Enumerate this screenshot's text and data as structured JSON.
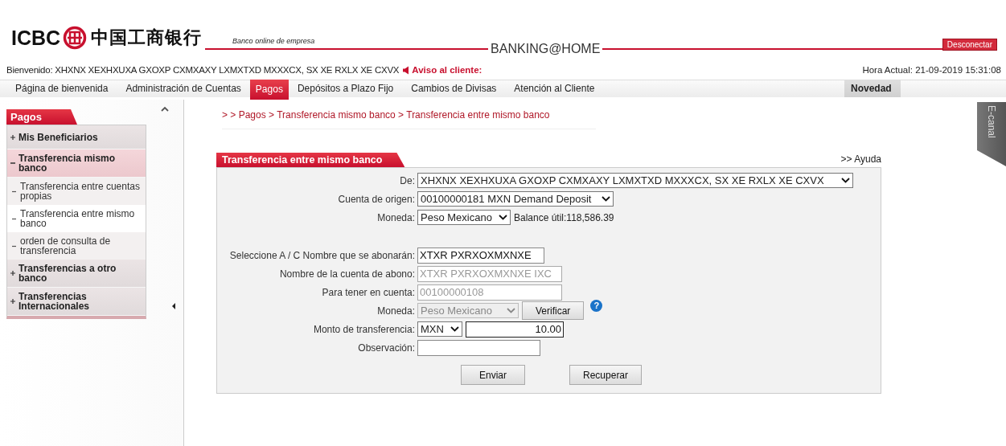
{
  "header": {
    "brand": "ICBC",
    "brand_cn": "中国工商银行",
    "tagline": "Banco online de empresa",
    "product": "BANKING@HOME",
    "logout": "Desconectar"
  },
  "welcome": {
    "label": "Bienvenido: XHXNX XEXHXUXA GXOXP CXMXAXY LXMXTXD MXXXCX, SX XE RXLX XE CXVX",
    "notice": "Aviso al cliente:",
    "clock": "Hora Actual: 21-09-2019 15:31:08"
  },
  "nav": {
    "items": [
      {
        "label": "Página de bienvenida",
        "selected": false
      },
      {
        "label": "Administración de Cuentas",
        "selected": false
      },
      {
        "label": "Pagos",
        "selected": true
      },
      {
        "label": "Depósitos a Plazo Fijo",
        "selected": false
      },
      {
        "label": "Cambios de Divisas",
        "selected": false
      },
      {
        "label": "Atención al Cliente",
        "selected": false
      }
    ],
    "extra": "Novedad"
  },
  "sidebar": {
    "title": "Pagos",
    "items": [
      {
        "label": "Mis Beneficiarios",
        "expanded": false
      },
      {
        "label": "Transferencia mismo banco",
        "expanded": true,
        "children": [
          {
            "label": "Transferencia entre cuentas propias",
            "selected": false
          },
          {
            "label": "Transferencia entre mismo banco",
            "selected": true
          },
          {
            "label": "orden de consulta de transferencia",
            "selected": false
          }
        ]
      },
      {
        "label": "Transferencias a otro banco",
        "expanded": false
      },
      {
        "label": "Transferencias Internacionales",
        "expanded": false
      }
    ]
  },
  "side_tab": "E-canal",
  "breadcrumb": "> > Pagos > Transferencia mismo banco > Transferencia entre mismo banco",
  "panel": {
    "title": "Transferencia entre mismo banco",
    "help_link": ">> Ayuda",
    "fields": [
      {
        "kind": "select",
        "label": "De:",
        "value": "XHXNX XEXHXUXA GXOXP CXMXAXY LXMXTXD MXXXCX, SX XE RXLX XE CXVX",
        "disabled": false
      },
      {
        "kind": "select",
        "label": "Cuenta de origen:",
        "value": "00100000181 MXN Demand Deposit",
        "disabled": false
      },
      {
        "kind": "select",
        "label": "Moneda:",
        "value": "Peso Mexicano",
        "disabled": false,
        "note": "Balance útil:118,586.39"
      },
      {
        "kind": "input",
        "label": "Seleccione A / C Nombre que se abonarán:",
        "value": "XTXR PXRXOXMXNXE",
        "disabled": false,
        "gap_before": true
      },
      {
        "kind": "input",
        "label": "Nombre de la cuenta de abono:",
        "value": "XTXR PXRXOXMXNXE IXC",
        "disabled": true
      },
      {
        "kind": "input",
        "label": "Para tener en cuenta:",
        "value": "00100000108",
        "disabled": true
      },
      {
        "kind": "select",
        "label": "Moneda:",
        "value": "Peso Mexicano",
        "disabled": true,
        "button": "Verificar",
        "help": "?"
      },
      {
        "kind": "amount",
        "label": "Monto de transferencia:",
        "currency": "MXN",
        "value": "10.00"
      },
      {
        "kind": "input",
        "label": "Observación:",
        "disabled": false
      }
    ],
    "buttons": [
      "Enviar",
      "Recuperar"
    ]
  }
}
